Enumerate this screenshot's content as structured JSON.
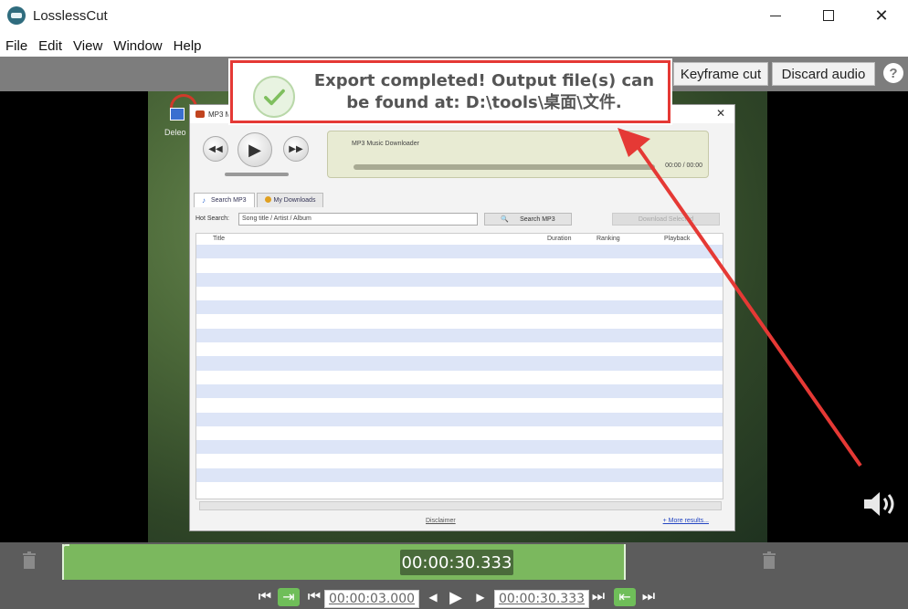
{
  "window": {
    "title": "LosslessCut"
  },
  "menu": [
    "File",
    "Edit",
    "View",
    "Window",
    "Help"
  ],
  "toolbar": {
    "keyframe_cut": "Keyframe cut",
    "discard_audio": "Discard audio",
    "help": "?"
  },
  "notification": {
    "line1": "Export completed! Output file(s) can",
    "line2": "be found at: D:\\tools\\桌面\\文件."
  },
  "video_content": {
    "desktop_icon_label": "Deleo",
    "app": {
      "title": "MP3 Music Downloader",
      "now_playing": "MP3 Music Downloader",
      "time": "00:00 / 00:00",
      "tabs": [
        "Search MP3",
        "My Downloads"
      ],
      "search_label": "Hot Search:",
      "search_placeholder": "Song title / Artist / Album",
      "search_button": "Search MP3",
      "download_button": "Download Selected",
      "columns": [
        "Title",
        "Duration",
        "Ranking",
        "Playback"
      ],
      "footer_disclaimer": "Disclaimer",
      "footer_more": "+ More results..."
    }
  },
  "timeline": {
    "current_time": "00:00:30.333"
  },
  "controls": {
    "cut_start": "00:00:03.000",
    "cut_end": "00:00:30.333"
  },
  "colors": {
    "accent_green": "#7bb85e",
    "annotation_red": "#e53935"
  }
}
